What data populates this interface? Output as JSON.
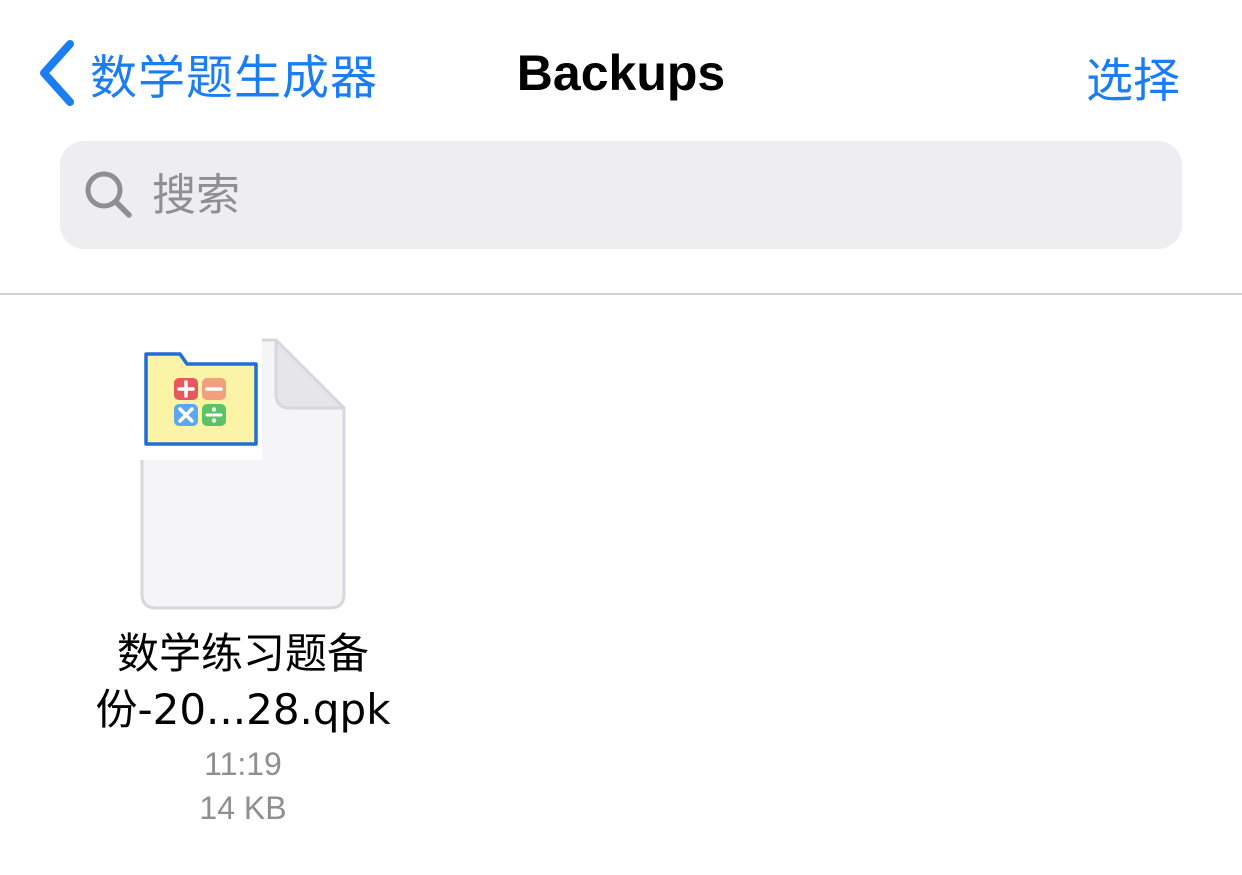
{
  "theme": {
    "accent": "#1a7ef2",
    "folder_outline": "#1f6fd6",
    "folder_fill": "#fbf4a6",
    "plus_tile": "#e8575e",
    "minus_tile": "#f0a07c",
    "times_tile": "#5aa8f0",
    "divide_tile": "#5cc266"
  },
  "nav": {
    "back_label": "数学题生成器",
    "back_icon": "chevron-left-icon",
    "title": "Backups",
    "select_label": "选择"
  },
  "search": {
    "icon": "magnifier-icon",
    "placeholder": "搜索",
    "value": ""
  },
  "files": [
    {
      "name_line1": "数学练习题备",
      "name_line2": "份-20...28.qpk",
      "time": "11:19",
      "size": "14 KB",
      "icon": "math-folder-icon"
    }
  ]
}
